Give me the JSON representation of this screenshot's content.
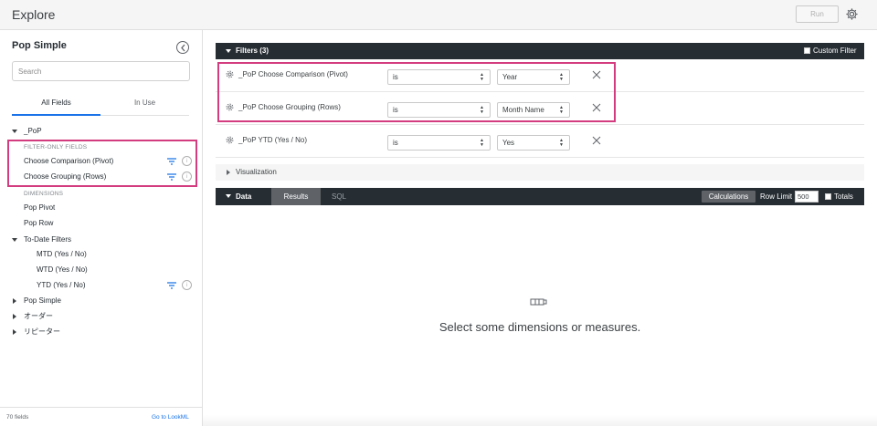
{
  "header": {
    "title": "Explore",
    "run_label": "Run"
  },
  "sidebar": {
    "model_title": "Pop Simple",
    "search_placeholder": "Search",
    "tabs": [
      {
        "label": "All Fields"
      },
      {
        "label": "In Use"
      }
    ],
    "view_name": "_PoP",
    "filter_only_label": "FILTER-ONLY FIELDS",
    "filter_only": [
      {
        "label": "Choose Comparison (Pivot)"
      },
      {
        "label": "Choose Grouping (Rows)"
      }
    ],
    "dimensions_label": "DIMENSIONS",
    "dimensions": [
      {
        "label": "Pop Pivot"
      },
      {
        "label": "Pop Row"
      }
    ],
    "group_to_date": "To-Date Filters",
    "to_date_items": [
      {
        "label": "MTD (Yes / No)"
      },
      {
        "label": "WTD (Yes / No)"
      },
      {
        "label": "YTD (Yes / No)"
      }
    ],
    "other_views": [
      {
        "label": "Pop Simple"
      },
      {
        "label": "オーダー"
      },
      {
        "label": "リピーター"
      }
    ],
    "footer": {
      "field_count": "70 fields",
      "go_lookml": "Go to LookML"
    }
  },
  "filters": {
    "title": "Filters (3)",
    "custom_filter_label": "Custom Filter",
    "rows": [
      {
        "label": "_PoP Choose Comparison (Pivot)",
        "operator": "is",
        "value": "Year"
      },
      {
        "label": "_PoP Choose Grouping (Rows)",
        "operator": "is",
        "value": "Month Name"
      },
      {
        "label": "_PoP YTD (Yes / No)",
        "operator": "is",
        "value": "Yes"
      }
    ]
  },
  "visualization": {
    "label": "Visualization"
  },
  "data": {
    "title": "Data",
    "tabs": [
      {
        "label": "Results"
      },
      {
        "label": "SQL"
      }
    ],
    "calculations_label": "Calculations",
    "row_limit_label": "Row Limit",
    "row_limit_value": "500",
    "totals_label": "Totals"
  },
  "empty_state": {
    "message": "Select some dimensions or measures."
  },
  "colors": {
    "accent": "#1a73e8",
    "highlight": "#d33d7f",
    "dark_bar": "#262d33"
  }
}
